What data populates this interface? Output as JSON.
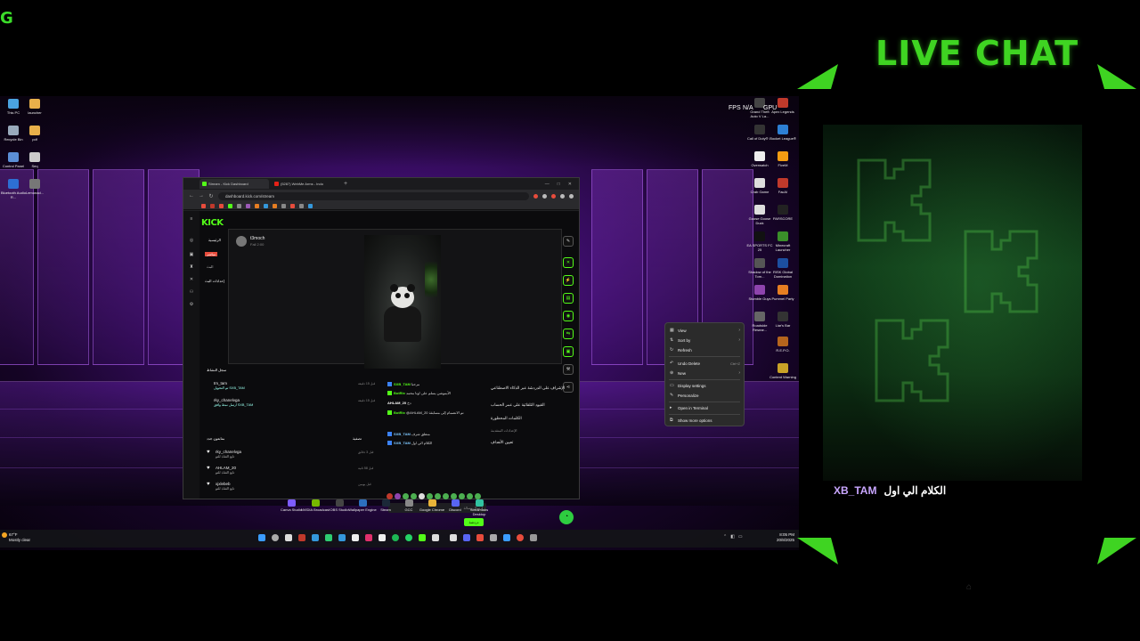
{
  "corner_glyph": "G",
  "live_chat": {
    "title": "LIVE CHAT",
    "accent_color": "#3fd422",
    "message_user": "XB_TAM",
    "message_text": "الكلام الي اول"
  },
  "desktop": {
    "left_icons": [
      {
        "label": "This PC",
        "icon": "pc-icon"
      },
      {
        "label": "launcher",
        "icon": "folder-icon"
      },
      {
        "label": "Recycle Bin",
        "icon": "recycle-bin-icon"
      },
      {
        "label": "pdf",
        "icon": "folder-icon"
      },
      {
        "label": "Control Panel",
        "icon": "control-panel-icon"
      },
      {
        "label": "Seq",
        "icon": "file-icon"
      },
      {
        "label": "Bluetooth Audio R...",
        "icon": "bluetooth-icon"
      },
      {
        "label": "Lemonad...",
        "icon": "file-icon"
      }
    ],
    "right_icons": [
      {
        "label": "Grand Theft Auto V La...",
        "icon": "game-icon"
      },
      {
        "label": "Apex Legends",
        "icon": "game-icon"
      },
      {
        "label": "Call of Duty® ...",
        "icon": "game-icon"
      },
      {
        "label": "Rocket League®",
        "icon": "game-icon"
      },
      {
        "label": "Overwatch",
        "icon": "game-icon"
      },
      {
        "label": "FiveM",
        "icon": "game-icon"
      },
      {
        "label": "Crab Game",
        "icon": "game-icon"
      },
      {
        "label": "FacAI",
        "icon": "game-icon"
      },
      {
        "label": "Goose Goose Duck",
        "icon": "game-icon"
      },
      {
        "label": "PARSCORE",
        "icon": "game-icon"
      },
      {
        "label": "EA SPORTS FC 25",
        "icon": "game-icon"
      },
      {
        "label": "Minecraft Launcher",
        "icon": "game-icon"
      },
      {
        "label": "Shadow of the Tom...",
        "icon": "game-icon"
      },
      {
        "label": "RISK Global Domination",
        "icon": "game-icon"
      },
      {
        "label": "Stumble Guys",
        "icon": "game-icon"
      },
      {
        "label": "Pummel Party",
        "icon": "game-icon"
      },
      {
        "label": "Roadside Resear...",
        "icon": "game-icon"
      },
      {
        "label": "Liar's Bar",
        "icon": "game-icon"
      },
      {
        "label": "R.E.P.O.",
        "icon": "game-icon"
      },
      {
        "label": "Content Warning",
        "icon": "game-icon"
      }
    ],
    "overlay": {
      "fps_label": "FPS",
      "fps_value": "N/A",
      "gpu_label": "GPU"
    }
  },
  "browser": {
    "tabs": [
      {
        "title": "Stream - Kick Dashboard",
        "active": true
      },
      {
        "title": "(5287) WebMe Arms - Indo",
        "active": false
      }
    ],
    "url": "dashboard.kick.com/stream",
    "kick": {
      "logo": "KICK",
      "streamer_name": "t3moch",
      "streamer_sub": "Fall 2:00",
      "live_badge": "مباشر",
      "nav_items": [
        "الرئيسية",
        "البث",
        "إعدادات البث"
      ],
      "activity_title": "سجل النشاط",
      "activity_filter": "تصفية",
      "activity_feed": [
        {
          "user": "tm_tam",
          "line": "تم التحويل SXB_TAM",
          "time": "قبل 15 دقيقة"
        },
        {
          "user": "rky_chanelvga",
          "line": "ارسل نمط وافق SXB_TAM",
          "time": "قبل 15 دقيقة"
        }
      ],
      "followers_title": "متابعون جدد",
      "followers": [
        {
          "user": "rky_chanelvga",
          "line": "تابع القناة للتو",
          "time": "قبل 3 دقائق"
        },
        {
          "user": "AHLAM_20",
          "line": "تابع القناة للتو",
          "time": "قبل 58 ثانية"
        },
        {
          "user": "xjxlebeb",
          "line": "تابع القناة للتو",
          "time": "قبل يومين"
        }
      ],
      "chat": [
        {
          "user": "SXB_TAM",
          "text": "مرحبا"
        },
        {
          "user": "BotRix",
          "text": "الأيموشن يسلم على اوتا محمد"
        },
        {
          "user": "AHLAM_20",
          "text": "دخ"
        },
        {
          "user": "BotRix",
          "text": "@AHLAM_20 تم الانضمام إلى مسابقة"
        },
        {
          "user": "SXB_TAM",
          "text": "منطق شرف"
        },
        {
          "user": "SXB_TAM",
          "text": "الكلام الي اول"
        }
      ],
      "chat_placeholder": "إرسال رسالة",
      "chat_send": "دردشة",
      "right_menu": [
        "الإشراف على الدردشة عبر الذكاء الاصطناعي",
        "القيود التلقائية على عمر الحساب",
        "الكلمات المحظورة",
        "تعيين الأهداف"
      ],
      "right_menu_sub": "الإعدادات المتقدمة"
    }
  },
  "context_menu": {
    "items": [
      {
        "label": "View",
        "icon": "view-icon",
        "submenu": true
      },
      {
        "label": "Sort by",
        "icon": "sort-icon",
        "submenu": true
      },
      {
        "label": "Refresh",
        "icon": "refresh-icon",
        "submenu": false
      },
      {
        "label": "Undo Delete",
        "icon": "undo-icon",
        "shortcut": "Ctrl+Z"
      },
      {
        "label": "New",
        "icon": "new-icon",
        "submenu": true
      },
      {
        "label": "Display settings",
        "icon": "display-icon"
      },
      {
        "label": "Personalize",
        "icon": "brush-icon"
      },
      {
        "label": "Open in Terminal",
        "icon": "terminal-icon"
      },
      {
        "label": "Show more options",
        "icon": "more-icon"
      }
    ]
  },
  "dock": [
    {
      "label": "Canva Studio"
    },
    {
      "label": "NVIDIA Broadcast"
    },
    {
      "label": "OBS Studio"
    },
    {
      "label": "Wallpaper Engine"
    },
    {
      "label": "Steam"
    },
    {
      "label": "GCC"
    },
    {
      "label": "Google Chrome"
    },
    {
      "label": "Discord"
    },
    {
      "label": "Streamlabs Desktop"
    }
  ],
  "taskbar": {
    "weather_temp": "67°F",
    "weather_desc": "Mostly clear",
    "time": "8:05 PM",
    "date": "20/8/2025"
  }
}
